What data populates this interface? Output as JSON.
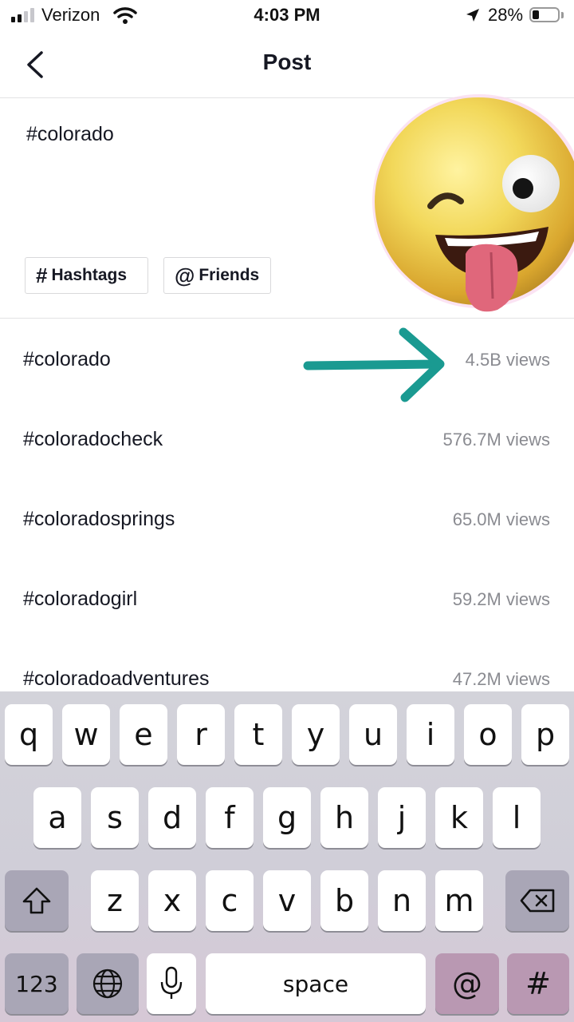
{
  "status_bar": {
    "carrier": "Verizon",
    "time": "4:03 PM",
    "battery_percent": "28%",
    "battery_level": 0.28,
    "signal_bars_filled": 2,
    "icons": [
      "signal-bars-icon",
      "wifi-icon",
      "location-arrow-icon",
      "battery-icon"
    ]
  },
  "header": {
    "title": "Post",
    "back_icon": "chevron-left-icon"
  },
  "caption": {
    "text": "#colorado"
  },
  "chips": {
    "hashtags_symbol": "#",
    "hashtags_label": "Hashtags",
    "friends_symbol": "@",
    "friends_label": "Friends"
  },
  "overlays": {
    "sticker": "winking-face-with-tongue-emoji",
    "pointer": "teal-arrow-icon"
  },
  "suggestions": [
    {
      "tag": "#colorado",
      "views": "4.5B views"
    },
    {
      "tag": "#coloradocheck",
      "views": "576.7M views"
    },
    {
      "tag": "#coloradosprings",
      "views": "65.0M views"
    },
    {
      "tag": "#coloradogirl",
      "views": "59.2M views"
    },
    {
      "tag": "#coloradoadventures",
      "views": "47.2M views"
    }
  ],
  "keyboard": {
    "row1": [
      "q",
      "w",
      "e",
      "r",
      "t",
      "y",
      "u",
      "i",
      "o",
      "p"
    ],
    "row2": [
      "a",
      "s",
      "d",
      "f",
      "g",
      "h",
      "j",
      "k",
      "l"
    ],
    "row3": [
      "z",
      "x",
      "c",
      "v",
      "b",
      "n",
      "m"
    ],
    "numbers_label": "123",
    "space_label": "space",
    "at_label": "@",
    "hash_label": "#",
    "icons": [
      "shift-icon",
      "backspace-icon",
      "globe-icon",
      "microphone-icon"
    ]
  },
  "colors": {
    "text": "#161823",
    "secondary_text": "#8a8b91",
    "arrow": "#1a9a91",
    "keyboard_accent": "#b998b2"
  }
}
